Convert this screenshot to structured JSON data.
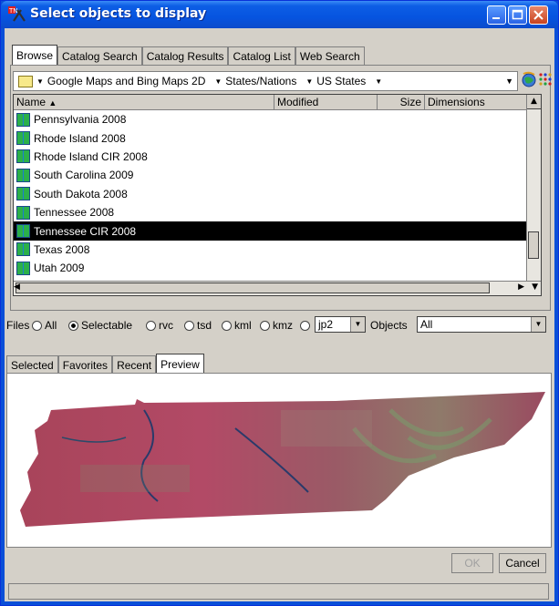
{
  "window": {
    "title": "Select objects to display",
    "colors": {
      "title_bar": "#0a4fd8",
      "selected_row": "#000000",
      "client": "#d4d0c8"
    }
  },
  "tabs": [
    {
      "label": "Browse",
      "active": true
    },
    {
      "label": "Catalog Search",
      "active": false
    },
    {
      "label": "Catalog Results",
      "active": false
    },
    {
      "label": "Catalog List",
      "active": false
    },
    {
      "label": "Web Search",
      "active": false
    }
  ],
  "path": {
    "crumbs": [
      "Google Maps and Bing Maps 2D",
      "States/Nations",
      "US States"
    ]
  },
  "table": {
    "columns": [
      "Name",
      "Modified",
      "Size",
      "Dimensions"
    ],
    "sort_indicator": "▲",
    "rows": [
      {
        "name": "Pennsylvania 2008",
        "selected": false
      },
      {
        "name": "Rhode Island 2008",
        "selected": false
      },
      {
        "name": "Rhode Island CIR 2008",
        "selected": false
      },
      {
        "name": "South Carolina 2009",
        "selected": false
      },
      {
        "name": "South Dakota 2008",
        "selected": false
      },
      {
        "name": "Tennessee 2008",
        "selected": false
      },
      {
        "name": "Tennessee CIR 2008",
        "selected": true
      },
      {
        "name": "Texas 2008",
        "selected": false
      },
      {
        "name": "Utah 2009",
        "selected": false
      }
    ]
  },
  "filters": {
    "files_label": "Files",
    "options": [
      {
        "label": "All",
        "selected": false
      },
      {
        "label": "Selectable",
        "selected": true
      },
      {
        "label": "rvc",
        "selected": false
      },
      {
        "label": "tsd",
        "selected": false
      },
      {
        "label": "kml",
        "selected": false
      },
      {
        "label": "kmz",
        "selected": false
      },
      {
        "label": "",
        "selected": false
      }
    ],
    "format_value": "jp2",
    "objects_label": "Objects",
    "objects_value": "All"
  },
  "lower_tabs": [
    {
      "label": "Selected",
      "active": false
    },
    {
      "label": "Favorites",
      "active": false
    },
    {
      "label": "Recent",
      "active": false
    },
    {
      "label": "Preview",
      "active": true
    }
  ],
  "buttons": {
    "ok": "OK",
    "cancel": "Cancel"
  }
}
